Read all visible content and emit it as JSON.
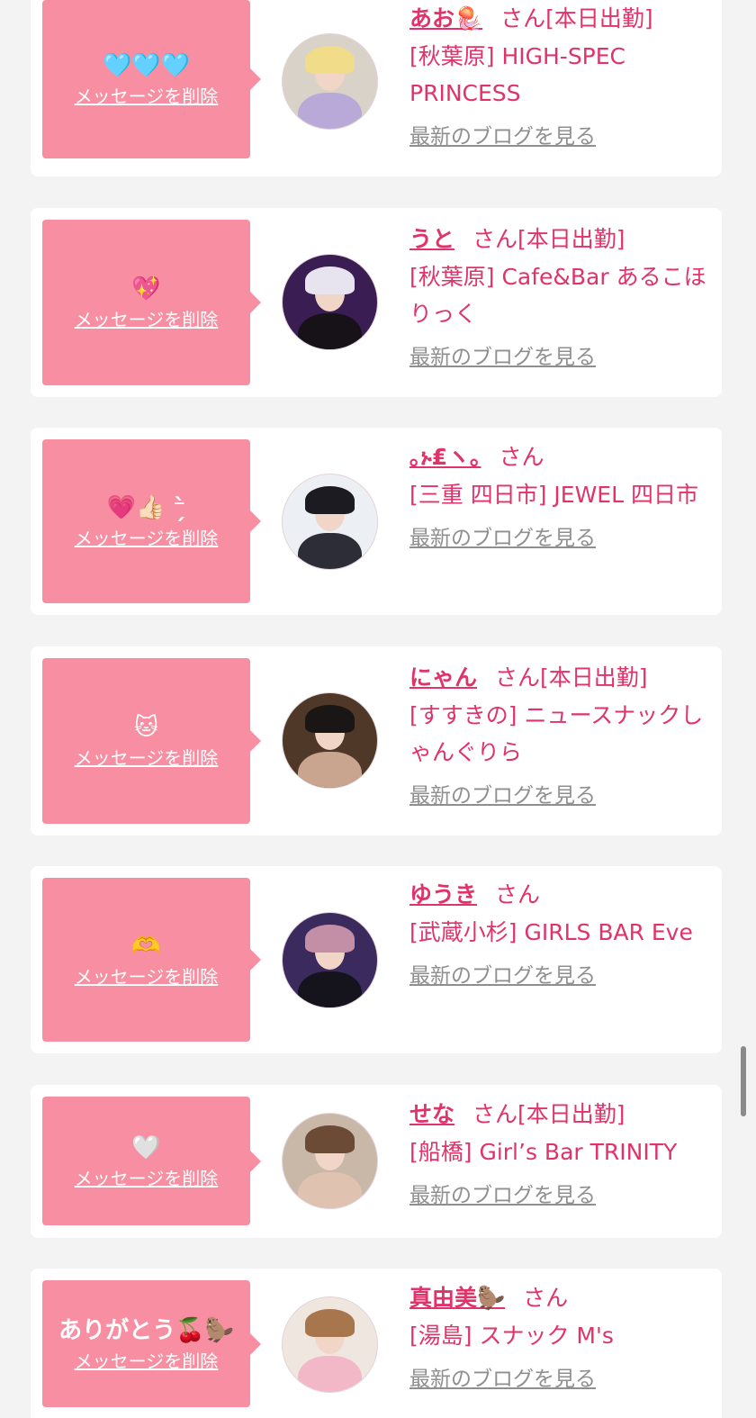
{
  "common": {
    "delete_label": "メッセージを削除",
    "blog_label": "最新のブログを見る",
    "san": "さん"
  },
  "items": [
    {
      "message": "🩵🩵🩵",
      "name": "あお🪼",
      "status": "[本日出勤]",
      "shop": "[秋葉原] HIGH-SPEC PRINCESS"
    },
    {
      "message": "💖",
      "name": "うと",
      "status": "[本日出勤]",
      "shop": "[秋葉原] Cafe&Bar あるこほりっく"
    },
    {
      "message": "💗👍🏻 ⁻̗̀",
      "name": "｡ኑ₤ヽ｡",
      "status": "",
      "shop": "[三重 四日市] JEWEL 四日市"
    },
    {
      "message": "🐱",
      "name": "にゃん",
      "status": "[本日出勤]",
      "shop": "[すすきの] ニュースナックしゃんぐりら"
    },
    {
      "message": "🫶",
      "name": "ゆうき",
      "status": "",
      "shop": "[武蔵小杉] GIRLS BAR Eve"
    },
    {
      "message": "🤍",
      "name": "せな",
      "status": "[本日出勤]",
      "shop": "[船橋] Girl’s Bar TRINITY"
    },
    {
      "message": "ありがとう🍒🦫",
      "name": "真由美🦫",
      "status": "",
      "shop": "[湯島] スナック M's"
    }
  ],
  "avatar_palettes": [
    {
      "bg": "#d8d2c8",
      "hair": "#f1dc8a",
      "body": "#b9a9d8"
    },
    {
      "bg": "#3a1d52",
      "hair": "#e8e4ef",
      "body": "#161218"
    },
    {
      "bg": "#eceff4",
      "hair": "#1c1b22",
      "body": "#2c2d36"
    },
    {
      "bg": "#4f3828",
      "hair": "#1b1616",
      "body": "#c9a48e"
    },
    {
      "bg": "#3b2a5e",
      "hair": "#c28fa6",
      "body": "#15131c"
    },
    {
      "bg": "#c9b8a8",
      "hair": "#6b4b36",
      "body": "#e0c2b0"
    },
    {
      "bg": "#efe6e0",
      "hair": "#a8764c",
      "body": "#f3b8c8"
    }
  ]
}
